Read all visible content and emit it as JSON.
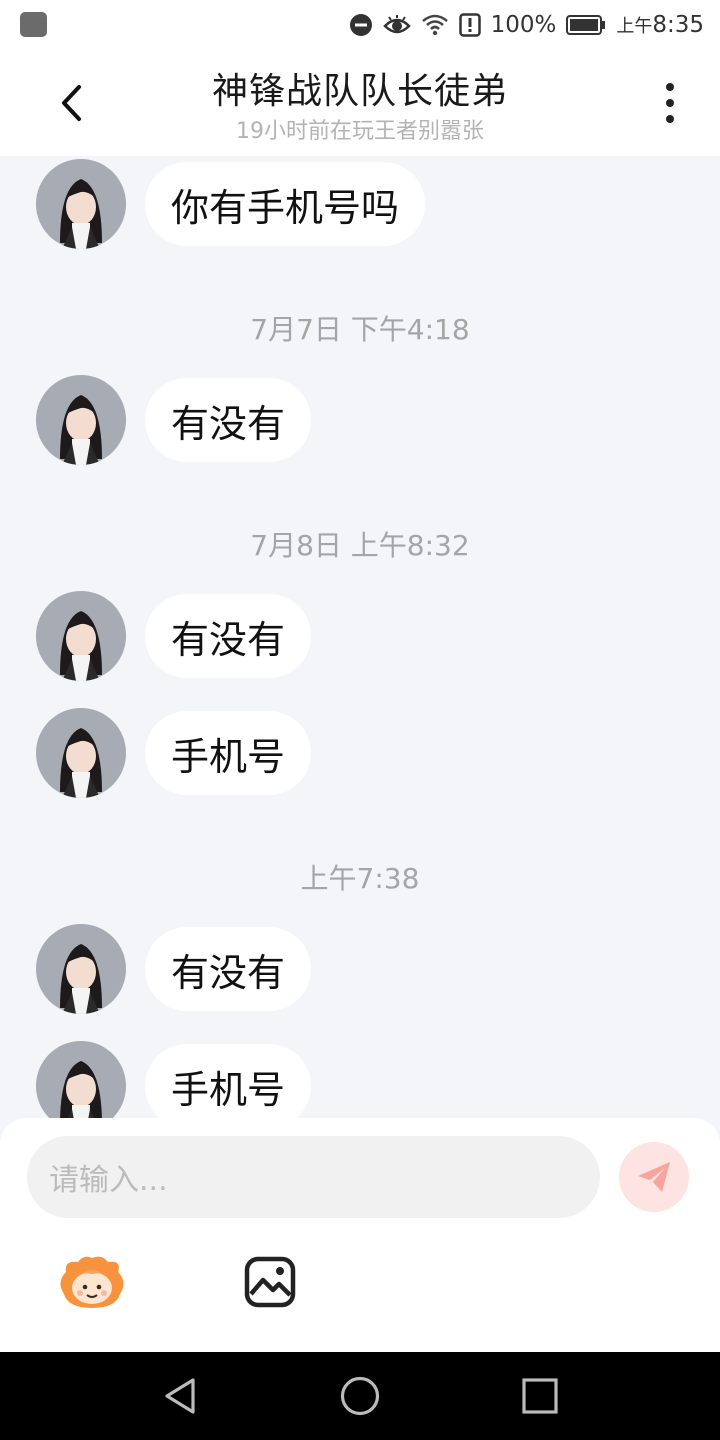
{
  "status_bar": {
    "battery_percent": "100%",
    "time_prefix": "上午",
    "time": "8:35",
    "icons": [
      "app-icon",
      "dnd-icon",
      "eye-icon",
      "wifi-icon",
      "alert-icon",
      "battery-icon"
    ]
  },
  "header": {
    "title": "神锋战队队长徒弟",
    "subtitle": "19小时前在玩王者别嚣张",
    "back_icon": "chevron-left-icon",
    "more_icon": "more-vertical-icon"
  },
  "chat": {
    "messages": [
      {
        "text": "你有手机号吗"
      },
      {
        "timestamp": "7月7日 下午4:18"
      },
      {
        "text": "有没有"
      },
      {
        "timestamp": "7月8日 上午8:32"
      },
      {
        "text": "有没有"
      },
      {
        "text": "手机号"
      },
      {
        "timestamp": "上午7:38"
      },
      {
        "text": "有没有"
      },
      {
        "text": "手机号"
      }
    ]
  },
  "composer": {
    "placeholder": "请输入...",
    "send_icon": "send-icon",
    "emoji_icon": "emoji-mascot-icon",
    "image_icon": "image-icon",
    "accent_color": "#f86a5e"
  },
  "nav_bar": {
    "icons": [
      "back-triangle-icon",
      "home-circle-icon",
      "recents-square-icon"
    ]
  }
}
